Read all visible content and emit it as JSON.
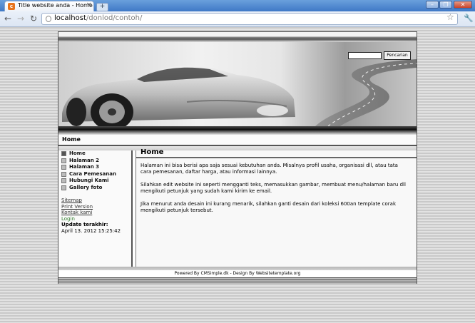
{
  "browser": {
    "tab_title": "Title website anda - Home",
    "tab_favicon": "cms-favicon-icon",
    "new_tab_label": "+",
    "url_host": "localhost",
    "url_path": "/donlod/contoh/",
    "window_controls": [
      "minimize",
      "restore",
      "close"
    ]
  },
  "site": {
    "search_button": "Pencarian",
    "breadcrumb": "Home",
    "menu": [
      {
        "label": "Home",
        "active": true
      },
      {
        "label": "Halaman 2"
      },
      {
        "label": "Halaman 3"
      },
      {
        "label": "Cara Pemesanan"
      },
      {
        "label": "Hubungi Kami"
      },
      {
        "label": "Gallery foto"
      }
    ],
    "side_links": {
      "sitemap": "Sitemap",
      "print": "Print Version",
      "contact": "Kontak kami",
      "login": "Login",
      "update_label": "Update terakhir:",
      "update_date": "April 13. 2012 15:25:42"
    },
    "content": {
      "title": "Home",
      "p1": "Halaman ini bisa berisi apa saja sesuai kebutuhan anda. Misalnya profil usaha, organisasi dll, atau tata cara pemesanan, daftar harga, atau informasi lainnya.",
      "p2": "Silahkan edit website ini seperti mengganti teks, memasukkan gambar, membuat menu/halaman baru dll mengikuti petunjuk yang sudah kami kirim ke email.",
      "p3": "Jika menurut anda desain ini kurang menarik, silahkan ganti desain dari koleksi 600an template corak mengikuti petunjuk tersebut."
    },
    "footer": "Powered By CMSimple.dk - Design By Websitetemplate.org"
  }
}
